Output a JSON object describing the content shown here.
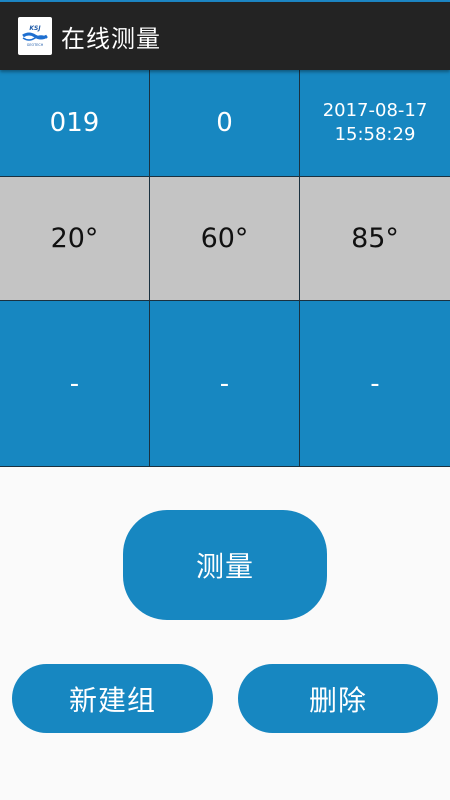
{
  "app_bar": {
    "title": "在线测量",
    "logo_text": "KSJ",
    "logo_subtext": "GEOTECH"
  },
  "grid": {
    "row1": {
      "number": "019",
      "count": "0",
      "date": "2017-08-17",
      "time": "15:58:29"
    },
    "angles": [
      "20°",
      "60°",
      "85°"
    ],
    "readings": [
      "-",
      "-",
      "-"
    ]
  },
  "buttons": {
    "measure": "测量",
    "new_group": "新建组",
    "delete": "删除"
  },
  "colors": {
    "accent": "#1787c1",
    "app_bar": "#232323",
    "angle_row": "#c4c4c4",
    "background": "#fafafa"
  }
}
